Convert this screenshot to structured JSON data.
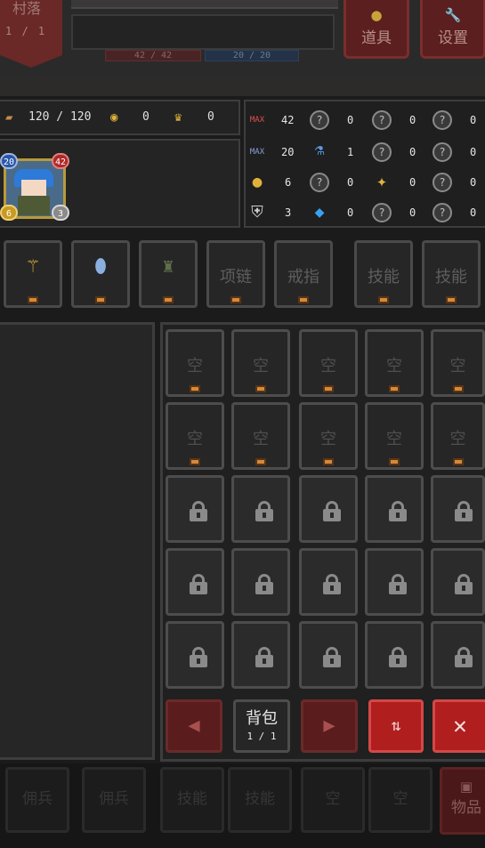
{
  "top": {
    "village_label": "村落",
    "village_level": "1 / 1",
    "hp_text": "42 / 42",
    "mp_text": "20 / 20",
    "items_button": "道具",
    "settings_button": "设置"
  },
  "resources": {
    "food": "120 / 120",
    "gold": "0",
    "crowns": "0"
  },
  "portrait": {
    "level": "20",
    "hp": "42",
    "gold": "6",
    "defense": "3"
  },
  "stats": {
    "rows": [
      {
        "c1": "42",
        "c2": "0",
        "c3": "0",
        "c4": "0"
      },
      {
        "c1": "20",
        "c2": "1",
        "c3": "0",
        "c4": "0"
      },
      {
        "c1": "6",
        "c2": "0",
        "c3": "0",
        "c4": "0"
      },
      {
        "c1": "3",
        "c2": "0",
        "c3": "0",
        "c4": "0"
      }
    ],
    "max_label": "MAX",
    "unknown_glyph": "?"
  },
  "equipment": {
    "necklace": "项链",
    "ring": "戒指",
    "skill1": "技能",
    "skill2": "技能"
  },
  "bag": {
    "empty_label": "空",
    "tab_label": "背包",
    "page": "1 / 1"
  },
  "bottom": {
    "slots": [
      "佣兵",
      "佣兵",
      "技能",
      "技能",
      "空",
      "空"
    ],
    "items_button": "物品"
  },
  "colors": {
    "accent_red": "#b01e1e",
    "frame": "#4d4d4d",
    "gold": "#e0b23a"
  },
  "icons": {
    "prev": "◀",
    "next": "▶",
    "sort": "⇅",
    "close": "✕"
  }
}
